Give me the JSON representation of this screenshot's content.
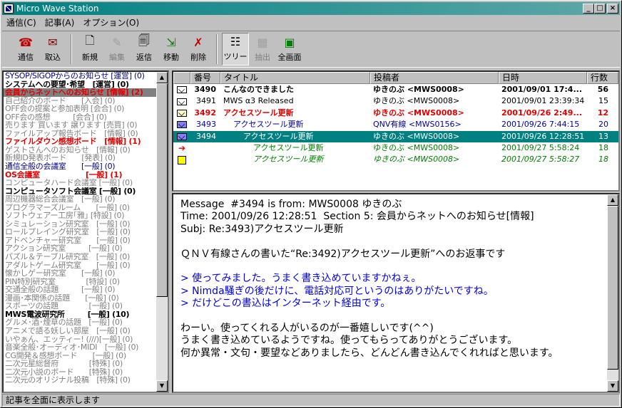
{
  "window": {
    "title": "Micro Wave Station"
  },
  "menu": [
    "通信(C)",
    "記事(A)",
    "オプション(O)"
  ],
  "toolbar": {
    "connect": "通信",
    "fetch": "取込",
    "new": "新規",
    "edit": "編集",
    "reply": "返信",
    "move": "移動",
    "delete": "削除",
    "tree": "ツリー",
    "extract": "抽出",
    "fullscreen": "全画面"
  },
  "forums": [
    {
      "label": "SYSOP/SIGOPからのお知らせ [運営] (0)",
      "style": "blue"
    },
    {
      "label": "システムへの要望･希望　[運営] (0)",
      "style": "bold"
    },
    {
      "label": "会員からネットへのお知らせ [情報] (2)",
      "style": "red sel"
    },
    {
      "label": "自己紹介のボード　　[入会] (0)",
      "style": ""
    },
    {
      "label": "OFF会の提案と参加表明 [会合] (0)",
      "style": ""
    },
    {
      "label": "OFF会の感想　　　[会合] (0)",
      "style": ""
    },
    {
      "label": "売ります 買います 譲ります [売買] (0)",
      "style": ""
    },
    {
      "label": "ファイルアップ報告ボード　[情報] (0)",
      "style": ""
    },
    {
      "label": "ファイルダウン感想ボード　[情報] (1)",
      "style": "red"
    },
    {
      "label": "ゲストさんへのお知らせ　[情報] (0)",
      "style": ""
    },
    {
      "label": "新規ID発表ボード　　[発表] (0)",
      "style": ""
    },
    {
      "label": "通信全般の会議室　　[一般] (0)",
      "style": "blue"
    },
    {
      "label": "OS会議室　　　　　　[一般] (1)",
      "style": "red"
    },
    {
      "label": "コンピュータハード会議室 [一般] (0)",
      "style": ""
    },
    {
      "label": "コンピュータソフト会議室 [一般] (0)",
      "style": "bold"
    },
    {
      "label": "周辺機器総合会議室　[一般] (0)",
      "style": ""
    },
    {
      "label": "プログラマーズルーム　　[一般] (0)",
      "style": ""
    },
    {
      "label": "ソフトウェアー工房｢雅｣ [特設] (0)",
      "style": ""
    },
    {
      "label": "シミュレーション研究室　[一般] (0)",
      "style": ""
    },
    {
      "label": "ロールプレイング研究室　[一般] (0)",
      "style": ""
    },
    {
      "label": "アドベンチャー研究室　　[一般] (0)",
      "style": ""
    },
    {
      "label": "アクション研究室　　　[一般] (0)",
      "style": ""
    },
    {
      "label": "パズル＆テーブル研究室　[一般] (0)",
      "style": ""
    },
    {
      "label": "アダルトゲーム研究室　　[一般] (0)",
      "style": ""
    },
    {
      "label": "懐かしゲー研究室　　[一般] (0)",
      "style": ""
    },
    {
      "label": "PIN特別研究室　　　　[特設] (0)",
      "style": ""
    },
    {
      "label": "交通全般の話題　　　[一般] (0)",
      "style": ""
    },
    {
      "label": "漫画･本関係の話題　　[一般] (0)",
      "style": ""
    },
    {
      "label": "スポーツの話題　　　　[一般] (0)",
      "style": ""
    },
    {
      "label": "MWS電波研究所　　　[一般] (10)",
      "style": "bold"
    },
    {
      "label": "グルメ･酒･煙草の話題　[一般] (0)",
      "style": ""
    },
    {
      "label": "アニメで語る妖しい部屋　[一般] (0)",
      "style": ""
    },
    {
      "label": "いやぁん、エッティー! (///)[一般] (0)",
      "style": ""
    },
    {
      "label": "音楽全般･オーディオ･MIDI　[一般] (0)",
      "style": ""
    },
    {
      "label": "CG開発＆感想ボード　　[一般] (0)",
      "style": ""
    },
    {
      "label": "二次元星総督府　　　　[特殊] (0)",
      "style": ""
    },
    {
      "label": "二次元小説のボード　　[特殊] (0)",
      "style": ""
    },
    {
      "label": "二次元のオリジナル投稿　[特殊] (0)",
      "style": ""
    }
  ],
  "table": {
    "headers": {
      "num": "番号",
      "title": "タイトル",
      "author": "投稿者",
      "date": "日時",
      "lines": "行数"
    },
    "rows": [
      {
        "icon": "env",
        "num": "3490",
        "title": "こんなのできました",
        "author": "ゆきのぶ <MWS0008>",
        "date": "2001/09/01 17:4...",
        "lines": "56",
        "style": "bold",
        "indent": 0
      },
      {
        "icon": "env",
        "num": "3491",
        "title": "MWS α3 Released",
        "author": "ゆきのぶ <MWS0008>",
        "date": "2001/09/01 23:39:34",
        "lines": "15",
        "style": "",
        "indent": 0
      },
      {
        "icon": "env-open",
        "num": "3492",
        "title": "アクセスツール更新",
        "author": "ゆきのぶ <MWS0008>",
        "date": "2001/09/26 2:49...",
        "lines": "12",
        "style": "red",
        "indent": 0
      },
      {
        "icon": "env-blue",
        "num": "3493",
        "title": "アクセスツール更新",
        "author": "QNV有線 <MWS0156>",
        "date": "2001/09/26 7:44:15",
        "lines": "20",
        "style": "blue",
        "indent": 1
      },
      {
        "icon": "env-blue",
        "num": "3494",
        "title": "アクセスツール更新",
        "author": "ゆきのぶ <MWS0008>",
        "date": "2001/09/26 12:28:51",
        "lines": "13",
        "style": "sel",
        "indent": 2
      },
      {
        "icon": "arrow",
        "num": "",
        "title": "アクセスツール更新",
        "author": "ゆきのぶ <MWS0008>",
        "date": "2001/09/27 5:58:24",
        "lines": "18",
        "style": "green",
        "indent": 3
      },
      {
        "icon": "pad",
        "num": "",
        "title": "アクセスツール更新",
        "author": "ゆきのぶ <MWS0008>",
        "date": "2001/09/27 5:58:27",
        "lines": "18",
        "style": "green italic",
        "indent": 3
      }
    ]
  },
  "message": {
    "header1": "Message  #3494 is from: MWS0008 ゆきのぶ",
    "header2": "Time: 2001/09/26 12:28:51  Section 5: 会員からネットへのお知らせ[情報]",
    "header3": "Subj: Re:3493)アクセスツール更新",
    "intro": "ＱＮＶ有線さんの書いた“Re:3492)アクセスツール更新”へのお返事です",
    "quote1": "> 使ってみました。うまく書き込めていますかねぇ。",
    "quote2": "> Nimda騒ぎの後だけに、電話対応可というのはありがたいですね。",
    "quote3": "> だけどこの書込はインターネット経由です。",
    "body1": "わーい。使ってくれる人がいるのが一番嬉しいです(^^)",
    "body2": "うまく書き込めているようですね。使ってもらってありがとうございます。",
    "body3": "何か異常・文句・要望などありましたら、どんどん書き込んでくれればと思います。"
  },
  "status": "記事を全面に表示します"
}
